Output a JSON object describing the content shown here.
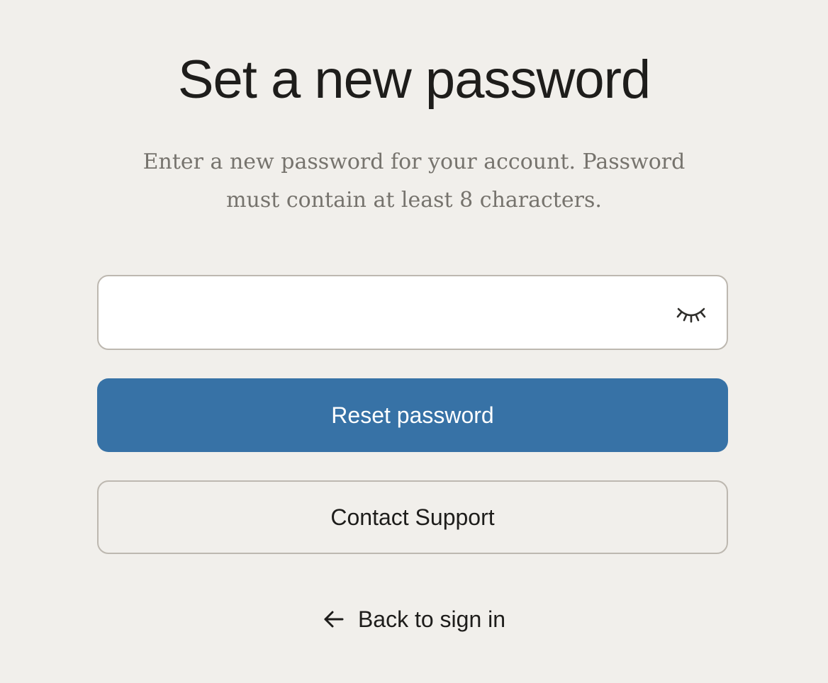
{
  "header": {
    "title": "Set a new password",
    "subtitle_line1": "Enter a new password for your account. Password",
    "subtitle_line2": "must contain at least 8 characters."
  },
  "password_field": {
    "value": "",
    "placeholder": "",
    "toggle_icon": "eye-closed-icon"
  },
  "actions": {
    "reset_label": "Reset password",
    "support_label": "Contact Support",
    "back_label": "Back to sign in",
    "back_icon": "arrow-left-icon"
  },
  "colors": {
    "background": "#f1efeb",
    "primary": "#3772a6",
    "border": "#bdb8b0",
    "text": "#1e1d1b",
    "muted_text": "#76736d"
  }
}
